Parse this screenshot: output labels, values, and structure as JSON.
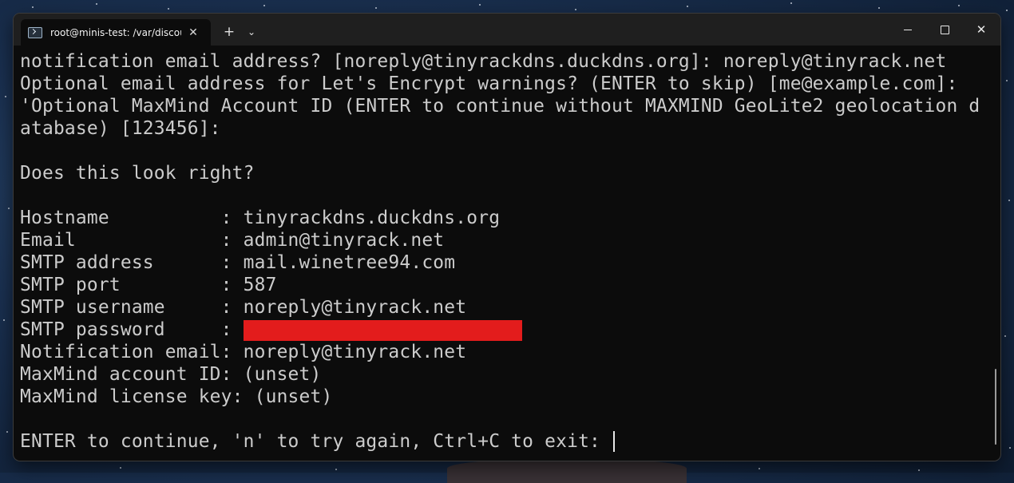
{
  "window": {
    "tab_title": "root@minis-test: /var/discour",
    "tab_close": "✕",
    "new_tab": "+",
    "dropdown": "⌄",
    "close": "✕"
  },
  "terminal": {
    "lines": [
      "notification email address? [noreply@tinyrackdns.duckdns.org]: noreply@tinyrack.net",
      "Optional email address for Let's Encrypt warnings? (ENTER to skip) [me@example.com]:",
      "'Optional MaxMind Account ID (ENTER to continue without MAXMIND GeoLite2 geolocation d",
      "atabase) [123456]:",
      "",
      "Does this look right?",
      "",
      "Hostname          : tinyrackdns.duckdns.org",
      "Email             : admin@tinyrack.net",
      "SMTP address      : mail.winetree94.com",
      "SMTP port         : 587",
      "SMTP username     : noreply@tinyrack.net",
      "SMTP password     : ",
      "Notification email: noreply@tinyrack.net",
      "MaxMind account ID: (unset)",
      "MaxMind license key: (unset)",
      "",
      "ENTER to continue, 'n' to try again, Ctrl+C to exit: "
    ],
    "redaction_color": "#e31c1c"
  }
}
